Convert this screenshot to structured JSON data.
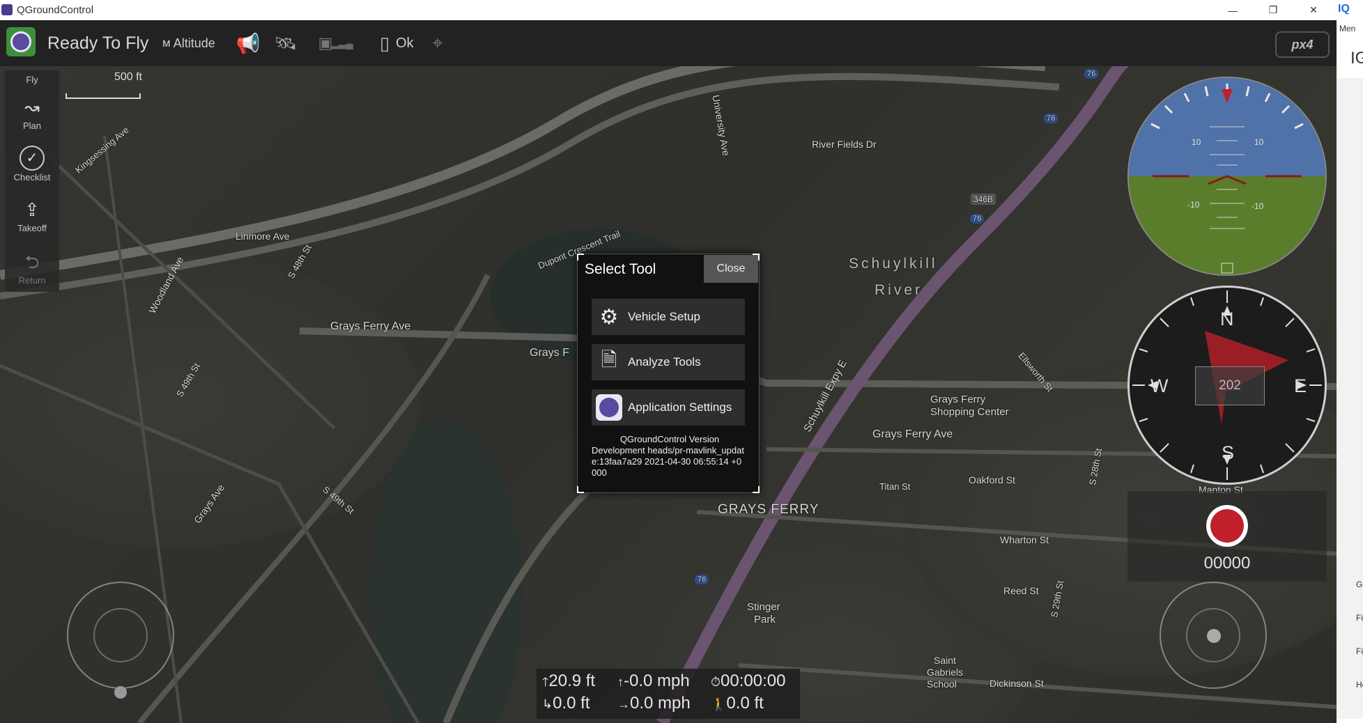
{
  "window": {
    "title": "QGroundControl",
    "controls": {
      "minimize": "—",
      "restore": "❐",
      "close": "✕"
    }
  },
  "toolbar": {
    "status": "Ready To Fly",
    "altitude_label": "Altitude",
    "battery_status": "Ok",
    "brand": "px4"
  },
  "toolstrip": {
    "items": [
      {
        "label": "Fly",
        "icon": "fly-icon"
      },
      {
        "label": "Plan",
        "icon": "plan-icon"
      },
      {
        "label": "Checklist",
        "icon": "checklist-icon"
      },
      {
        "label": "Takeoff",
        "icon": "takeoff-icon"
      },
      {
        "label": "Return",
        "icon": "return-icon"
      }
    ]
  },
  "map": {
    "scale_label": "500 ft",
    "labels": {
      "grays_ferry_ave": "Grays Ferry Ave",
      "grays_ferry_ave_right": "Grays Ferry Ave",
      "grays_ferry_ave_mid": "Grays F",
      "grays_ferry": "GRAYS FERRY",
      "schuylkill": "Schuylkill",
      "river": "River",
      "river_fields_dr": "River Fields Dr",
      "shopping_center_1": "Grays Ferry",
      "shopping_center_2": "Shopping Center",
      "university_ave": "University Ave",
      "stinger_park_1": "Stinger",
      "stinger_park_2": "Park",
      "linmore_ave": "Linmore Ave",
      "woodland_ave": "Woodland Ave",
      "dupont_crescent_trail": "Dupont Crescent Trail",
      "schuylkill_expy": "Schuylkill Expy E",
      "s_48th_st": "S 48th St",
      "s_49th_st": "S 49th St",
      "kingsessing_ave": "Kingsessing Ave",
      "wharton_st": "Wharton St",
      "reed_st": "Reed St",
      "dickinson_st": "Dickinson St",
      "saint_gabriels_1": "Saint",
      "saint_gabriels_2": "Gabriels",
      "saint_gabriels_3": "School",
      "oakford_st": "Oakford St",
      "titan_st": "Titan St",
      "s_28th_st": "S 28th St",
      "s_29th_st": "S 29th St",
      "manton_st": "Manton St",
      "ellsworth_st": "Ellsworth St",
      "grays_ave": "Grays Ave",
      "s_49th_st_b": "S 49th St",
      "shield_76_a": "76",
      "shield_76_b": "76",
      "shield_76_c": "76",
      "shield_76_d": "76",
      "shield_346b": "346B"
    }
  },
  "dialog": {
    "title": "Select Tool",
    "close_label": "Close",
    "tools": [
      {
        "label": "Vehicle Setup",
        "icon": "gears-icon"
      },
      {
        "label": "Analyze Tools",
        "icon": "analyze-icon"
      },
      {
        "label": "Application Settings",
        "icon": "qgc-logo-icon"
      }
    ],
    "version_title": "QGroundControl Version",
    "version_line1": "Development heads/pr-mavlink_updat",
    "version_line2": "e:13faa7a29 2021-04-30 06:55:14 +0",
    "version_line3": "000"
  },
  "telemetry": {
    "altitude": "20.9 ft",
    "vertical_speed": "-0.0 mph",
    "flight_time": "00:00:00",
    "distance": "0.0 ft",
    "horizontal_speed": "0.0 mph",
    "distance_home": "0.0 ft"
  },
  "attitude": {
    "pitch_labels": [
      "10",
      "10",
      "-10",
      "-10"
    ],
    "sky_color": "#4f72a8",
    "ground_color": "#5a7d2c"
  },
  "compass": {
    "n": "N",
    "s": "S",
    "e": "E",
    "w": "W",
    "heading": "202"
  },
  "recording": {
    "counter": "00000"
  },
  "side_panel": {
    "labels": [
      "IQ",
      "Men",
      "IG",
      "Gi",
      "Fi",
      "Fi",
      "He"
    ]
  }
}
